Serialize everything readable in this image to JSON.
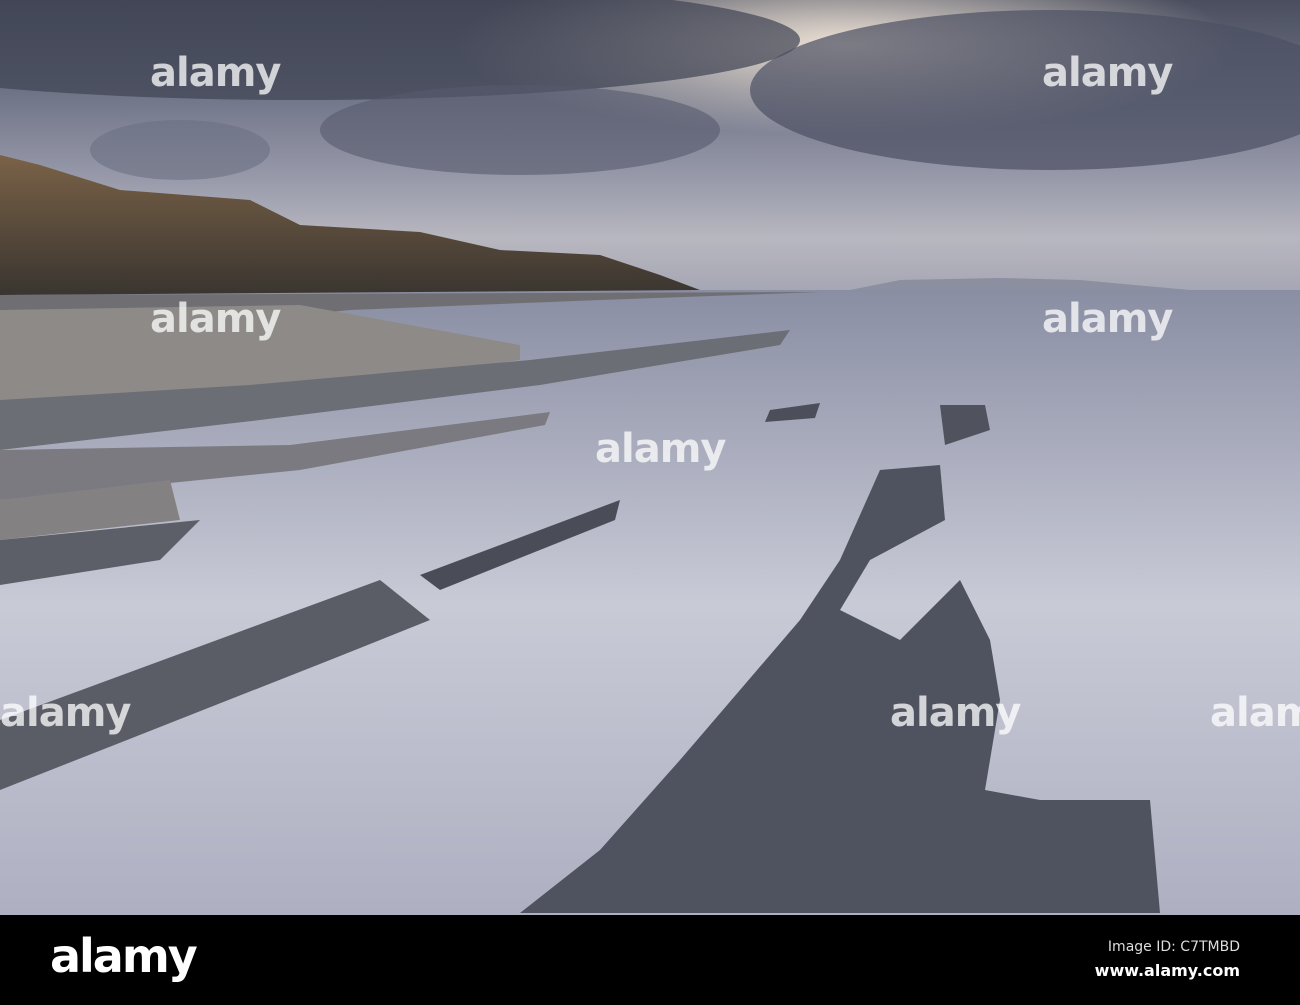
{
  "photo": {
    "watermark": "alamy",
    "subject": "long exposure seascape, rock ledges and cliffs"
  },
  "footer": {
    "logo": "alamy",
    "image_id": "Image ID: C7TMBD",
    "url": "www.alamy.com"
  }
}
